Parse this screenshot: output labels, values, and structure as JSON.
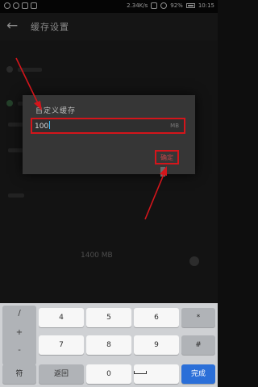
{
  "status_bar": {
    "speed": "2.34K/s",
    "battery": "92%",
    "time": "10:15"
  },
  "header": {
    "back_glyph": "←",
    "title": "缓存设置"
  },
  "background": {
    "value_text": "1400 MB"
  },
  "dialog": {
    "title": "自定义缓存",
    "input_value": "100",
    "input_unit": "MB",
    "ok_label": "确定"
  },
  "keypad": {
    "symbols": [
      "/",
      "+",
      "-"
    ],
    "keys": [
      "4",
      "5",
      "6",
      "7",
      "8",
      "9",
      "0"
    ],
    "dot": "*",
    "hash": "#",
    "sym_label": "符",
    "back_label": "返回",
    "done_label": "完成"
  },
  "annotations": {
    "arrow_color": "#d4151b"
  }
}
